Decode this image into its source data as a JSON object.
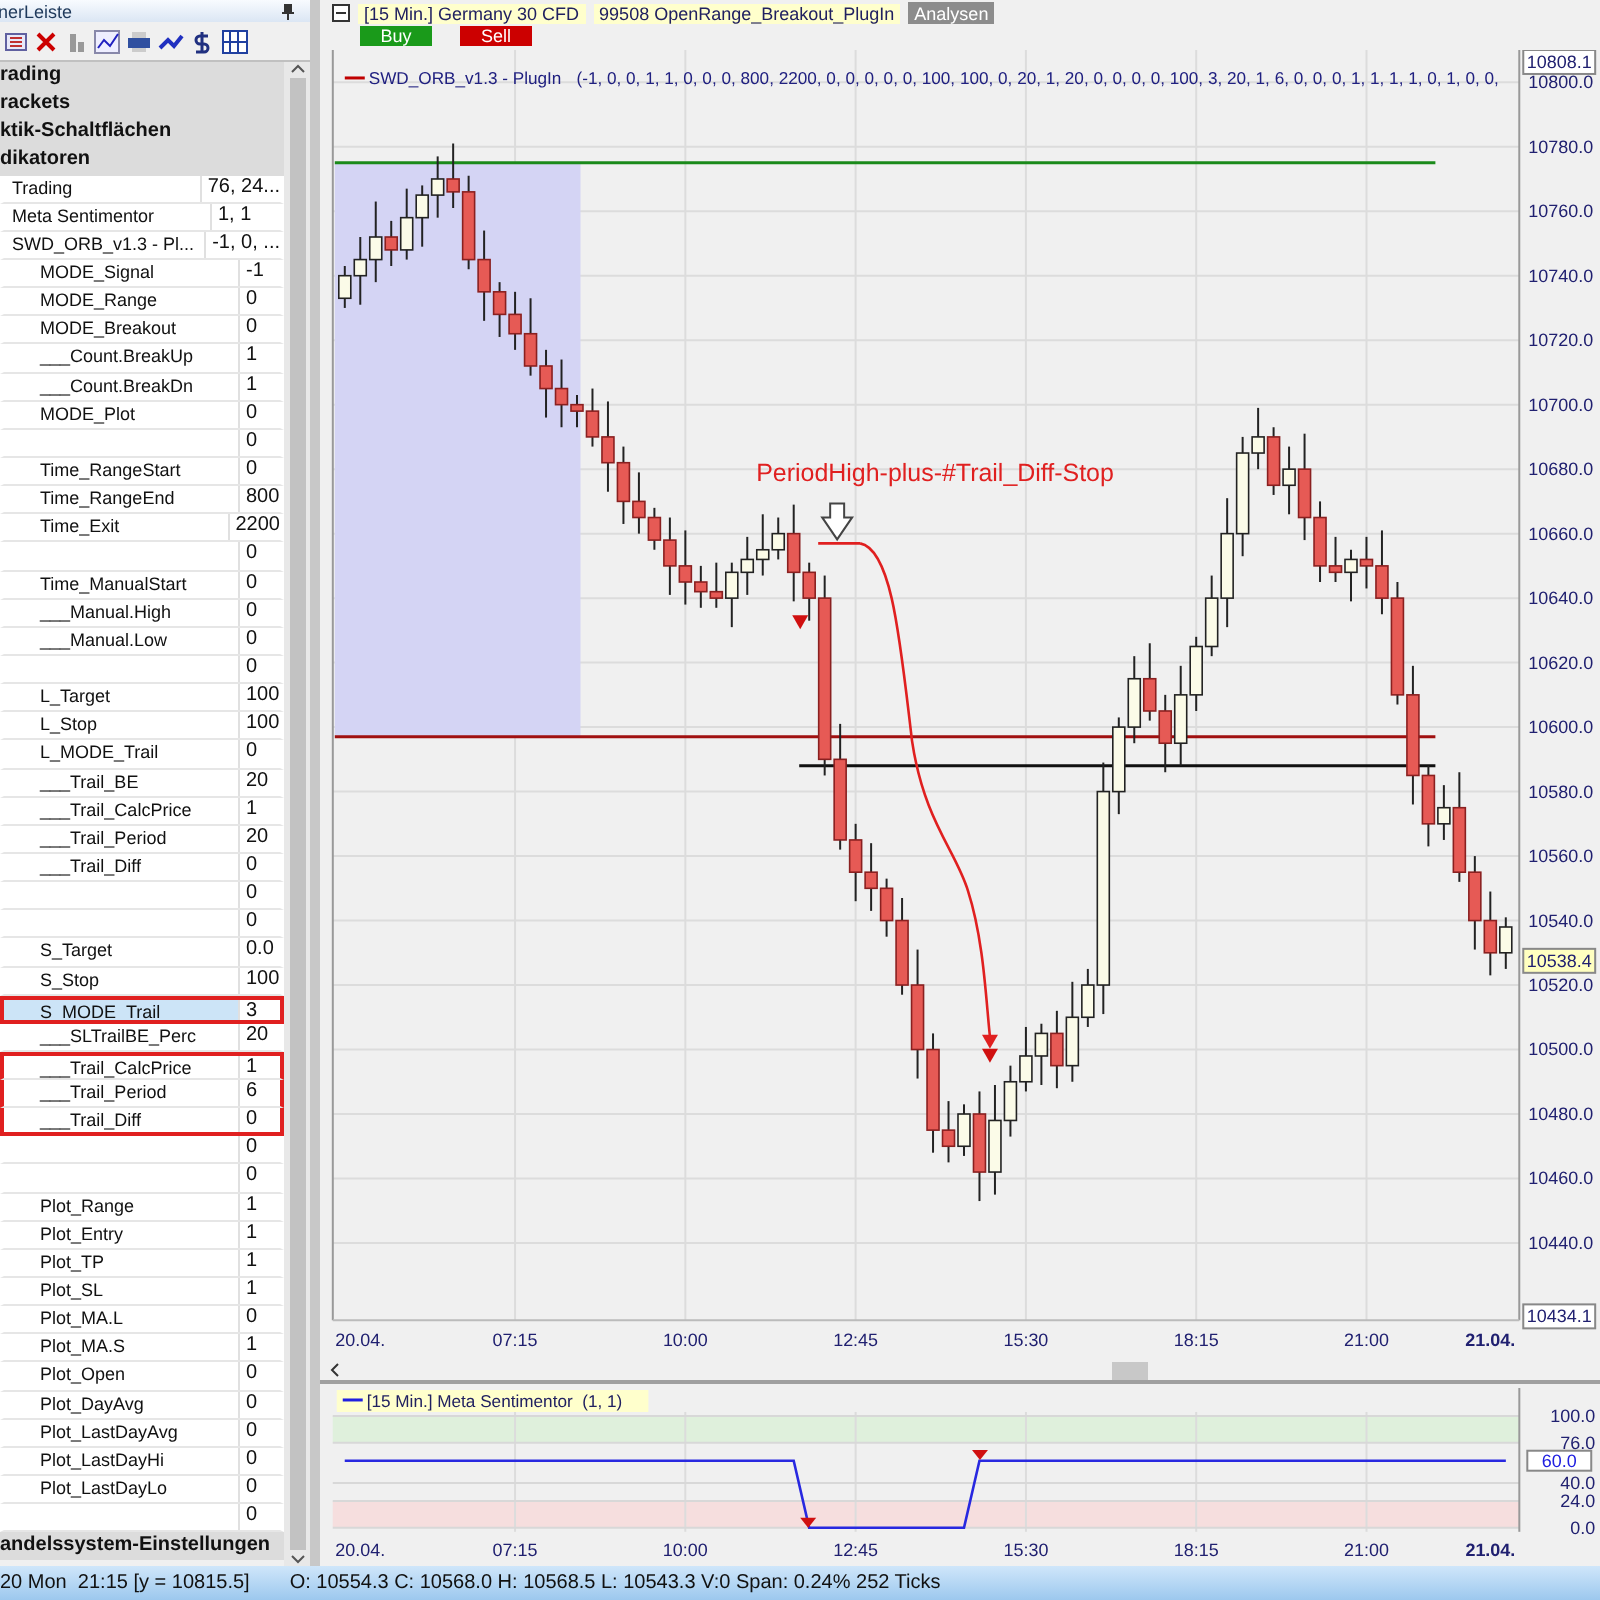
{
  "side_panel": {
    "title": "nerLeiste",
    "sections": [
      {
        "label": "rading"
      },
      {
        "label": "rackets"
      },
      {
        "label": "ktik-Schaltflächen"
      },
      {
        "label": "dikatoren",
        "items": [
          {
            "name": "Trading",
            "value": "76, 24...",
            "selected": false,
            "outlined": false
          },
          {
            "name": "Meta Sentimentor",
            "value": "1, 1",
            "selected": false,
            "outlined": false
          },
          {
            "name": "SWD_ORB_v1.3 - Pl...",
            "value": "-1, 0, ...",
            "selected": false,
            "outlined": false,
            "children": [
              {
                "name": "MODE_Signal",
                "value": "-1",
                "selected": false,
                "outlined": false
              },
              {
                "name": "MODE_Range",
                "value": "0",
                "selected": false,
                "outlined": false
              },
              {
                "name": "MODE_Breakout",
                "value": "0",
                "selected": false,
                "outlined": false
              },
              {
                "name": "___Count.BreakUp",
                "value": "1",
                "selected": false,
                "outlined": false
              },
              {
                "name": "___Count.BreakDn",
                "value": "1",
                "selected": false,
                "outlined": false
              },
              {
                "name": "MODE_Plot",
                "value": "0",
                "selected": false,
                "outlined": false
              },
              {
                "value": "0",
                "selected": false,
                "outlined": false
              },
              {
                "name": "Time_RangeStart",
                "value": "0",
                "selected": false,
                "outlined": false
              },
              {
                "name": "Time_RangeEnd",
                "value": "800",
                "selected": false,
                "outlined": false
              },
              {
                "name": "Time_Exit",
                "value": "2200",
                "selected": false,
                "outlined": false
              },
              {
                "value": "0",
                "selected": false,
                "outlined": false
              },
              {
                "name": "Time_ManualStart",
                "value": "0",
                "selected": false,
                "outlined": false
              },
              {
                "name": "___Manual.High",
                "value": "0",
                "selected": false,
                "outlined": false
              },
              {
                "name": "___Manual.Low",
                "value": "0",
                "selected": false,
                "outlined": false
              },
              {
                "value": "0",
                "selected": false,
                "outlined": false
              },
              {
                "name": "L_Target",
                "value": "100",
                "selected": false,
                "outlined": false
              },
              {
                "name": "L_Stop",
                "value": "100",
                "selected": false,
                "outlined": false
              },
              {
                "name": "L_MODE_Trail",
                "value": "0",
                "selected": false,
                "outlined": false
              },
              {
                "name": "___Trail_BE",
                "value": "20",
                "selected": false,
                "outlined": false
              },
              {
                "name": "___Trail_CalcPrice",
                "value": "1",
                "selected": false,
                "outlined": false
              },
              {
                "name": "___Trail_Period",
                "value": "20",
                "selected": false,
                "outlined": false
              },
              {
                "name": "___Trail_Diff",
                "value": "0",
                "selected": false,
                "outlined": false
              },
              {
                "value": "0",
                "selected": false,
                "outlined": false
              },
              {
                "value": "0",
                "selected": false,
                "outlined": false
              },
              {
                "name": "S_Target",
                "value": "0.0",
                "selected": false,
                "outlined": false
              },
              {
                "name": "S_Stop",
                "value": "100",
                "selected": false,
                "outlined": false
              },
              {
                "name": "S_MODE_Trail",
                "value": "3",
                "selected": true,
                "outlined": true
              },
              {
                "name": "___SLTrailBE_Perc",
                "value": "20",
                "selected": false,
                "outlined": false
              },
              {
                "name": "___Trail_CalcPrice",
                "value": "1",
                "selected": false,
                "outlined": true
              },
              {
                "name": "___Trail_Period",
                "value": "6",
                "selected": false,
                "outlined": true
              },
              {
                "name": "___Trail_Diff",
                "value": "0",
                "selected": false,
                "outlined": true
              },
              {
                "value": "0",
                "selected": false,
                "outlined": false
              },
              {
                "value": "0",
                "selected": false,
                "outlined": false
              },
              {
                "name": "Plot_Range",
                "value": "1",
                "selected": false,
                "outlined": false
              },
              {
                "name": "Plot_Entry",
                "value": "1",
                "selected": false,
                "outlined": false
              },
              {
                "name": "Plot_TP",
                "value": "1",
                "selected": false,
                "outlined": false
              },
              {
                "name": "Plot_SL",
                "value": "1",
                "selected": false,
                "outlined": false
              },
              {
                "name": "Plot_MA.L",
                "value": "0",
                "selected": false,
                "outlined": false
              },
              {
                "name": "Plot_MA.S",
                "value": "1",
                "selected": false,
                "outlined": false
              },
              {
                "name": "Plot_Open",
                "value": "0",
                "selected": false,
                "outlined": false
              },
              {
                "name": "Plot_DayAvg",
                "value": "0",
                "selected": false,
                "outlined": false
              },
              {
                "name": "Plot_LastDayAvg",
                "value": "0",
                "selected": false,
                "outlined": false
              },
              {
                "name": "Plot_LastDayHi",
                "value": "0",
                "selected": false,
                "outlined": false
              },
              {
                "name": "Plot_LastDayLo",
                "value": "0",
                "selected": false,
                "outlined": false
              },
              {
                "value": "0",
                "selected": false,
                "outlined": false
              }
            ]
          }
        ]
      },
      {
        "label": "andelssystem-Einstellungen"
      }
    ]
  },
  "chart": {
    "title": "[15 Min.] Germany 30 CFD",
    "strategy": "99508 OpenRange_Breakout_PlugIn",
    "analysis_button": "Analysen",
    "order_buttons": [
      {
        "label": "Buy",
        "color": "#1a9a1a"
      },
      {
        "label": "Sell",
        "color": "#cc0000"
      }
    ],
    "indicator_name": "SWD_ORB_v1.3 - PlugIn",
    "indicator_params": "(-1, 0, 0, 1, 1, 0, 0, 0, 800, 2200, 0, 0, 0, 0, 0, 100, 100, 0, 20, 1, 20, 0, 0, 0, 0, 100, 3, 20, 1, 6, 0, 0, 0, 1, 1, 1, 1, 0, 1, 0, 0,",
    "annotation": "PeriodHigh-plus-#Trail_Diff-Stop",
    "chart_data": {
      "type": "candlestick",
      "categories": [
        null,
        "20.04.",
        null,
        null,
        null,
        null,
        null,
        null,
        null,
        null,
        null,
        "07:15",
        null,
        null,
        null,
        null,
        null,
        null,
        null,
        null,
        null,
        null,
        "10:00",
        null,
        null,
        null,
        null,
        null,
        null,
        null,
        null,
        null,
        null,
        "12:45",
        null,
        null,
        null,
        null,
        null,
        null,
        null,
        null,
        null,
        null,
        "15:30",
        null,
        null,
        null,
        null,
        null,
        null,
        null,
        null,
        null,
        null,
        "18:15",
        null,
        null,
        null,
        null,
        null,
        null,
        null,
        null,
        null,
        null,
        "21:00",
        null,
        null,
        null,
        null,
        null,
        null,
        null,
        "21.04.",
        null
      ],
      "ohlc": [
        [
          10733,
          10743,
          10730,
          10740
        ],
        [
          10740,
          10752,
          10731,
          10745
        ],
        [
          10745,
          10763,
          10738,
          10752
        ],
        [
          10752,
          10757,
          10743,
          10748
        ],
        [
          10748,
          10767,
          10745,
          10758
        ],
        [
          10758,
          10768,
          10749,
          10765
        ],
        [
          10765,
          10777,
          10758,
          10770
        ],
        [
          10770,
          10781,
          10761,
          10766
        ],
        [
          10766,
          10771,
          10742,
          10745
        ],
        [
          10745,
          10754,
          10726,
          10735
        ],
        [
          10735,
          10738,
          10721,
          10728
        ],
        [
          10728,
          10735,
          10717,
          10722
        ],
        [
          10722,
          10733,
          10709,
          10712
        ],
        [
          10712,
          10717,
          10696,
          10705
        ],
        [
          10705,
          10714,
          10693,
          10700
        ],
        [
          10700,
          10703,
          10693,
          10698
        ],
        [
          10698,
          10705,
          10687,
          10690
        ],
        [
          10690,
          10701,
          10673,
          10682
        ],
        [
          10682,
          10687,
          10663,
          10670
        ],
        [
          10670,
          10679,
          10660,
          10665
        ],
        [
          10665,
          10668,
          10655,
          10658
        ],
        [
          10658,
          10665,
          10641,
          10650
        ],
        [
          10650,
          10661,
          10638,
          10645
        ],
        [
          10645,
          10650,
          10637,
          10642
        ],
        [
          10642,
          10651,
          10637,
          10640
        ],
        [
          10640,
          10651,
          10631,
          10648
        ],
        [
          10648,
          10659,
          10641,
          10652
        ],
        [
          10652,
          10666,
          10647,
          10655
        ],
        [
          10655,
          10665,
          10652,
          10660
        ],
        [
          10660,
          10669,
          10639,
          10648
        ],
        [
          10648,
          10651,
          10633,
          10640
        ],
        [
          10640,
          10647,
          10585,
          10590
        ],
        [
          10590,
          10601,
          10562,
          10565
        ],
        [
          10565,
          10570,
          10546,
          10555
        ],
        [
          10555,
          10564,
          10543,
          10550
        ],
        [
          10550,
          10553,
          10535,
          10540
        ],
        [
          10540,
          10547,
          10517,
          10520
        ],
        [
          10520,
          10531,
          10491,
          10500
        ],
        [
          10500,
          10505,
          10468,
          10475
        ],
        [
          10475,
          10484,
          10465,
          10470
        ],
        [
          10470,
          10483,
          10467,
          10480
        ],
        [
          10480,
          10487,
          10453,
          10462
        ],
        [
          10462,
          10489,
          10455,
          10478
        ],
        [
          10478,
          10495,
          10473,
          10490
        ],
        [
          10490,
          10507,
          10487,
          10498
        ],
        [
          10498,
          10508,
          10489,
          10505
        ],
        [
          10505,
          10512,
          10488,
          10495
        ],
        [
          10495,
          10521,
          10490,
          10510
        ],
        [
          10510,
          10525,
          10507,
          10520
        ],
        [
          10520,
          10589,
          10511,
          10580
        ],
        [
          10580,
          10603,
          10573,
          10600
        ],
        [
          10600,
          10622,
          10595,
          10615
        ],
        [
          10615,
          10626,
          10602,
          10605
        ],
        [
          10605,
          10610,
          10586,
          10595
        ],
        [
          10595,
          10619,
          10588,
          10610
        ],
        [
          10610,
          10628,
          10605,
          10625
        ],
        [
          10625,
          10647,
          10622,
          10640
        ],
        [
          10640,
          10671,
          10631,
          10660
        ],
        [
          10660,
          10690,
          10653,
          10685
        ],
        [
          10685,
          10699,
          10680,
          10690
        ],
        [
          10690,
          10693,
          10672,
          10675
        ],
        [
          10675,
          10687,
          10666,
          10680
        ],
        [
          10680,
          10691,
          10658,
          10665
        ],
        [
          10665,
          10670,
          10645,
          10650
        ],
        [
          10650,
          10659,
          10645,
          10648
        ],
        [
          10648,
          10655,
          10639,
          10652
        ],
        [
          10652,
          10659,
          10643,
          10650
        ],
        [
          10650,
          10661,
          10635,
          10640
        ],
        [
          10640,
          10645,
          10607,
          10610
        ],
        [
          10610,
          10619,
          10576,
          10585
        ],
        [
          10585,
          10588,
          10563,
          10570
        ],
        [
          10570,
          10582,
          10565,
          10575
        ],
        [
          10575,
          10586,
          10552,
          10555
        ],
        [
          10555,
          10560,
          10531,
          10540
        ],
        [
          10540,
          10549,
          10523,
          10530
        ],
        [
          10530,
          10541,
          10525,
          10538
        ]
      ],
      "grid": true,
      "ylim": [
        10416,
        10810
      ],
      "ref_lines": [
        {
          "axis": "y",
          "value": 10775,
          "color": "#1a8a1a"
        },
        {
          "axis": "y",
          "value": 10597,
          "color": "#a01010"
        },
        {
          "axis": "y",
          "value": 10588,
          "color": "#111111"
        }
      ],
      "yticks": [
        {
          "value": 10800,
          "label": "10800.0"
        },
        {
          "value": 10780,
          "label": "10780.0"
        },
        {
          "value": 10760,
          "label": "10760.0"
        },
        {
          "value": 10740,
          "label": "10740.0"
        },
        {
          "value": 10720,
          "label": "10720.0"
        },
        {
          "value": 10700,
          "label": "10700.0"
        },
        {
          "value": 10680,
          "label": "10680.0"
        },
        {
          "value": 10660,
          "label": "10660.0"
        },
        {
          "value": 10640,
          "label": "10640.0"
        },
        {
          "value": 10620,
          "label": "10620.0"
        },
        {
          "value": 10600,
          "label": "10600.0"
        },
        {
          "value": 10580,
          "label": "10580.0"
        },
        {
          "value": 10560,
          "label": "10560.0"
        },
        {
          "value": 10540,
          "label": "10540.0"
        },
        {
          "value": 10520,
          "label": "10520.0"
        },
        {
          "value": 10500,
          "label": "10500.0"
        },
        {
          "value": 10480,
          "label": "10480.0"
        },
        {
          "value": 10460,
          "label": "10460.0"
        },
        {
          "value": 10440,
          "label": "10440.0"
        }
      ]
    },
    "price_markers": [
      "10808.1",
      "10538.4",
      "10434.1"
    ]
  },
  "sub_chart": {
    "legend": "[15 Min.] Meta Sentimentor  (1, 1)",
    "chart_data": {
      "type": "line",
      "categories": [
        null,
        "20.04.",
        null,
        null,
        null,
        null,
        null,
        null,
        null,
        null,
        null,
        "07:15",
        null,
        null,
        null,
        null,
        null,
        null,
        null,
        null,
        null,
        null,
        "10:00",
        null,
        null,
        null,
        null,
        null,
        null,
        null,
        null,
        null,
        null,
        "12:45",
        null,
        null,
        null,
        null,
        null,
        null,
        null,
        null,
        null,
        null,
        "15:30",
        null,
        null,
        null,
        null,
        null,
        null,
        null,
        null,
        null,
        null,
        "18:15",
        null,
        null,
        null,
        null,
        null,
        null,
        null,
        null,
        null,
        null,
        "21:00",
        null,
        null,
        null,
        null,
        null,
        null,
        null,
        "21.04.",
        null
      ],
      "series": [
        {
          "color": "#2828e0",
          "values": [
            60,
            60,
            60,
            60,
            60,
            60,
            60,
            60,
            60,
            60,
            60,
            60,
            60,
            60,
            60,
            60,
            60,
            60,
            60,
            60,
            60,
            60,
            60,
            60,
            60,
            60,
            60,
            60,
            60,
            60,
            0,
            0,
            0,
            0,
            0,
            0,
            0,
            0,
            0,
            0,
            0,
            60,
            60,
            60,
            60,
            60,
            60,
            60,
            60,
            60,
            60,
            60,
            60,
            60,
            60,
            60,
            60,
            60,
            60,
            60,
            60,
            60,
            60,
            60,
            60,
            60,
            60,
            60,
            60,
            60,
            60,
            60,
            60,
            60,
            60,
            60
          ]
        }
      ],
      "grid": true,
      "bands": [
        {
          "axis": "y",
          "from": 76,
          "to": 100,
          "color": "#dff0dc"
        },
        {
          "axis": "y",
          "from": 0,
          "to": 24,
          "color": "#f6dede"
        }
      ],
      "ylim": [
        -3.6,
        103.6
      ],
      "yticks": [
        {
          "value": 100,
          "label": "100.0"
        },
        {
          "value": 76,
          "label": "76.0"
        },
        {
          "value": 40,
          "label": "40.0"
        },
        {
          "value": 24,
          "label": "24.0"
        },
        {
          "value": 0,
          "label": "0.0"
        }
      ]
    },
    "value_marker": "60.0"
  },
  "status_bar": {
    "position": "20 Mon  21:15 [y = 10815.5]",
    "ohlc": "O: 10554.3 C: 10568.0 H: 10568.5 L: 10543.3 V:0 Span: 0.24% 252 Ticks"
  }
}
